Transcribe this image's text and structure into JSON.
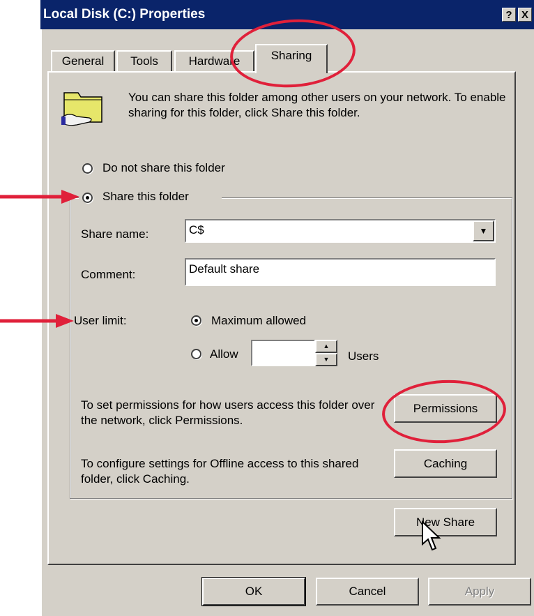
{
  "window": {
    "title": "Local Disk (C:) Properties",
    "help_button": "?",
    "close_button": "X"
  },
  "tabs": [
    {
      "label": "General",
      "active": false
    },
    {
      "label": "Tools",
      "active": false
    },
    {
      "label": "Hardware",
      "active": false
    },
    {
      "label": "Sharing",
      "active": true
    }
  ],
  "sharing": {
    "intro": "You can share this folder among other users on your network.  To enable sharing for this folder, click Share this folder.",
    "icon": "shared-folder-icon",
    "option_no_share": "Do not share this folder",
    "option_share": "Share this folder",
    "selected_option": "Share this folder",
    "share_name_label": "Share name:",
    "share_name_value": "C$",
    "comment_label": "Comment:",
    "comment_value": "Default share",
    "user_limit_label": "User limit:",
    "user_limit_max": "Maximum allowed",
    "user_limit_allow": "Allow",
    "user_limit_units": "Users",
    "user_limit_selected": "Maximum allowed",
    "user_limit_count": "",
    "permissions_text": "To set permissions for how users access this folder over the network, click Permissions.",
    "permissions_button": "Permissions",
    "caching_text": "To configure settings for Offline access to this shared folder, click Caching.",
    "caching_button": "Caching",
    "new_share_button": "New Share"
  },
  "footer": {
    "ok": "OK",
    "cancel": "Cancel",
    "apply": "Apply",
    "apply_enabled": false
  },
  "annotations": {
    "highlight_color": "#e0203a"
  }
}
